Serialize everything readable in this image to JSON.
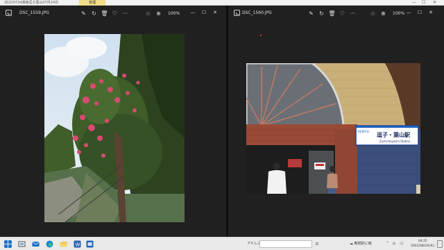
{
  "explorer_strip": {
    "path": "20220724湘南逗子葉山07月24日",
    "manage_tab": "管理",
    "minimize": "—",
    "maximize": "☐",
    "close": "✕"
  },
  "left_window": {
    "filename": "DSC_1559.JPG",
    "zoom": "100%",
    "minimize": "—",
    "maximize": "☐",
    "close": "✕"
  },
  "right_window": {
    "filename": "DSC_1560.JPG",
    "zoom": "100%",
    "minimize": "—",
    "maximize": "☐",
    "close": "✕",
    "photo": {
      "station_sign_brand": "KEIKYU",
      "station_sign_name": "逗子・葉山駅",
      "station_sign_romaji": "Zushi·Hayama Station"
    }
  },
  "taskbar": {
    "address_label": "アドレス",
    "weather_text": "断続的に雨",
    "time": "18:35",
    "date": "2022/08/24(水)",
    "start_color": "#1a73c9"
  }
}
